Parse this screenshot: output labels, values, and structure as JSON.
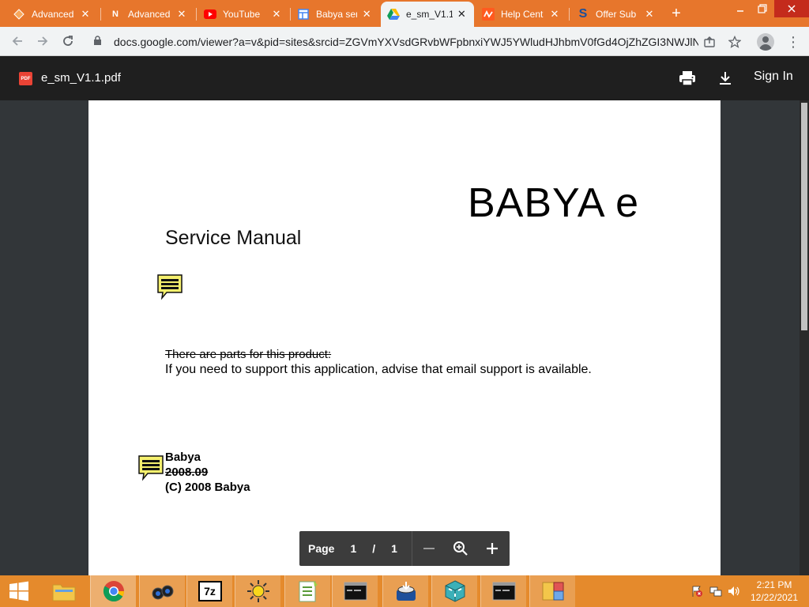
{
  "browser": {
    "tabs": [
      {
        "title": "Advanced",
        "icon": "orange-diamond-icon",
        "active": false
      },
      {
        "title": "Advanced",
        "icon": "n-logo-icon",
        "active": false
      },
      {
        "title": "YouTube",
        "icon": "youtube-icon",
        "active": false
      },
      {
        "title": "Babya ser",
        "icon": "sheet-icon",
        "active": false
      },
      {
        "title": "e_sm_V1.1",
        "icon": "google-drive-icon",
        "active": true
      },
      {
        "title": "Help Cent",
        "icon": "zigzag-icon",
        "active": false
      },
      {
        "title": "Offer Sub",
        "icon": "s-logo-icon",
        "active": false
      }
    ],
    "url": "docs.google.com/viewer?a=v&pid=sites&srcid=ZGVmYXVsdGRvbWFpbnxiYWJ5YWludHJhbmV0fGd4OjZhZGI3NWJlN"
  },
  "viewer": {
    "file_name": "e_sm_V1.1.pdf",
    "pdf_badge": "PDF",
    "sign_in": "Sign In"
  },
  "document": {
    "title": "BABYA e",
    "subtitle": "Service Manual",
    "struck_line": "There are  parts for this product:  ",
    "body_line": "If you need to support this application, advise that email support is available.",
    "company": "Babya",
    "struck_date": "2008.09",
    "copyright": "(C) 2008 Babya"
  },
  "page_control": {
    "label": "Page",
    "current": "1",
    "separator": "/",
    "total": "1"
  },
  "taskbar": {
    "apps": [
      "start",
      "file-explorer",
      "chrome",
      "binoculars",
      "7zip",
      "sun",
      "notepad-plus",
      "cmd",
      "installer",
      "cube",
      "cmd-2",
      "folders"
    ],
    "sevenzip_label": "7z"
  },
  "clock": {
    "time": "2:21 PM",
    "date": "12/22/2021"
  },
  "colors": {
    "tabstrip": "#e7762c",
    "taskbar": "#e58a2c",
    "viewer_header": "#1f1f1f",
    "viewer_background": "#323639",
    "comment_note": "#f5f06e"
  }
}
